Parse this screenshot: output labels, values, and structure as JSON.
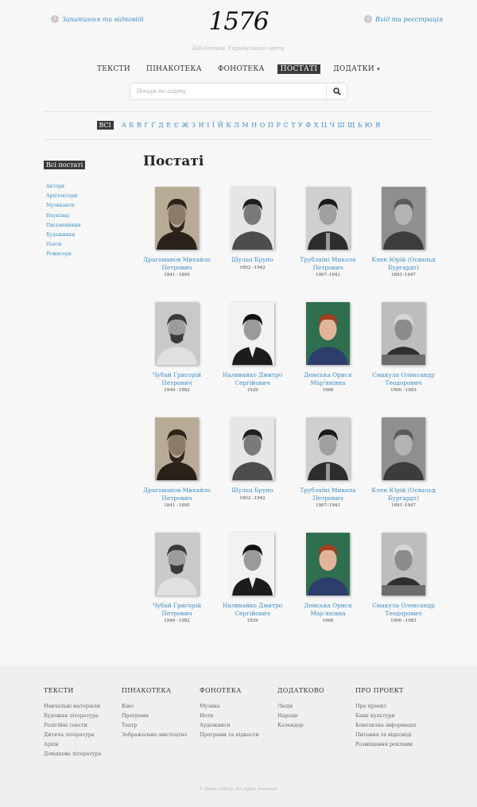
{
  "header": {
    "faq_link": "Запитання та відповіді",
    "faq_icon": "?",
    "login_link": "Вхід та реєстрація",
    "login_icon": "+",
    "logo": "1576",
    "tagline": "Бібліотека Українського світу"
  },
  "nav": {
    "items": [
      "ТЕКСТИ",
      "ПІНАКОТЕКА",
      "ФОНОТЕКА",
      "ПОСТАТІ",
      "ДОДАТКИ"
    ],
    "active": "ПОСТАТІ",
    "dropdown_caret": "▾"
  },
  "search": {
    "placeholder": "Пошук по сайту",
    "icon": "search-icon"
  },
  "alphabet": {
    "all_label": "ВСІ",
    "letters": [
      "А",
      "Б",
      "В",
      "Г",
      "Ґ",
      "Д",
      "Е",
      "Є",
      "Ж",
      "З",
      "И",
      "І",
      "Ї",
      "Й",
      "К",
      "Л",
      "М",
      "Н",
      "О",
      "П",
      "Р",
      "С",
      "Т",
      "У",
      "Ф",
      "Х",
      "Ц",
      "Ч",
      "Ш",
      "Щ",
      "Ь",
      "Ю",
      "Я"
    ]
  },
  "sidebar": {
    "title": "Всі постаті",
    "items": [
      "Актори",
      "Архітектори",
      "Музиканти",
      "Науковці",
      "Письменники",
      "Художники",
      "Поети",
      "Режисери"
    ]
  },
  "main": {
    "title": "Постаті",
    "people": [
      {
        "name": "Драгоманов Михайло Петрович",
        "dates": "1841 –1895",
        "photo": "portrait-bearded"
      },
      {
        "name": "Шульц Бруно",
        "dates": "1892 –1942",
        "photo": "portrait-suit"
      },
      {
        "name": "Трублаїні Микола Петрович",
        "dates": "1907–1941",
        "photo": "portrait-tie"
      },
      {
        "name": "Клен Юрій (Освальд Бургардт)",
        "dates": "1891–1947",
        "photo": "portrait-old"
      },
      {
        "name": "Чубай Григорій Петрович",
        "dates": "1949 –1982",
        "photo": "portrait-mustache"
      },
      {
        "name": "Наливайко Дмитро Сергійович",
        "dates": "1929",
        "photo": "portrait-suit-bw"
      },
      {
        "name": "Демська Орися Мар'янівна",
        "dates": "1966",
        "photo": "portrait-color"
      },
      {
        "name": "Смакула Олександр Теодорович",
        "dates": "1900 –1983",
        "photo": "portrait-desk"
      },
      {
        "name": "Драгоманов Михайло Петрович",
        "dates": "1841 –1895",
        "photo": "portrait-bearded"
      },
      {
        "name": "Шульц Бруно",
        "dates": "1892 –1942",
        "photo": "portrait-suit"
      },
      {
        "name": "Трублаїні Микола Петрович",
        "dates": "1907–1941",
        "photo": "portrait-tie"
      },
      {
        "name": "Клен Юрій (Освальд Бургардт)",
        "dates": "1891–1947",
        "photo": "portrait-old"
      },
      {
        "name": "Чубай Григорій Петрович",
        "dates": "1949 –1982",
        "photo": "portrait-mustache"
      },
      {
        "name": "Наливайко Дмитро Сергійович",
        "dates": "1929",
        "photo": "portrait-suit-bw"
      },
      {
        "name": "Демська Орися Мар'янівна",
        "dates": "1966",
        "photo": "portrait-color"
      },
      {
        "name": "Смакула Олександр Теодорович",
        "dates": "1900 –1983",
        "photo": "portrait-desk"
      }
    ]
  },
  "footer": {
    "columns": [
      {
        "title": "ТЕКСТИ",
        "links": [
          "Навчальні матеріали",
          "Художня література",
          "Релігійні тексти",
          "Дитяча література",
          "Архів",
          "Довідкова література"
        ]
      },
      {
        "title": "ПІНАКОТЕКА",
        "links": [
          "Кіно",
          "Програми",
          "Театр",
          "Зображальне мистецтво"
        ]
      },
      {
        "title": "ФОНОТЕКА",
        "links": [
          "Музика",
          "Ноти",
          "Аудіокниги",
          "Програми та підкасти"
        ]
      },
      {
        "title": "ДОДАТКОВО",
        "links": [
          "Люди",
          "Народи",
          "Календар"
        ]
      },
      {
        "title": "ПРО ПРОЕКТ",
        "links": [
          "Про проект",
          "Банк культури",
          "Контактна інформація",
          "Питання та відповіді",
          "Розміщення реклами"
        ]
      }
    ],
    "copyright": "© Bank cultury. All rights reserved."
  },
  "colors": {
    "link": "#3f8fc8",
    "active_bg": "#3a3a3a",
    "footer_bg": "#efefef"
  }
}
